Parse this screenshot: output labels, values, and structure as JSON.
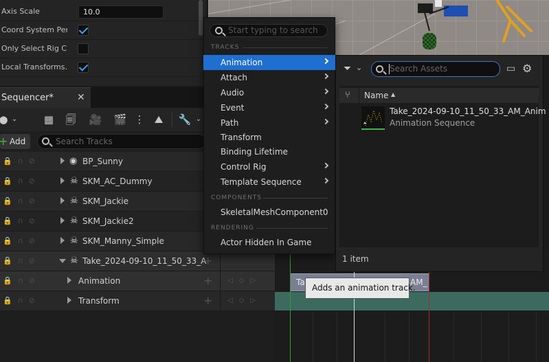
{
  "details": {
    "rows": [
      {
        "label": "Axis Scale",
        "value": "10.0"
      },
      {
        "label": "Coord System Per…",
        "checked": true
      },
      {
        "label": "Only Select Rig C…",
        "checked": false
      },
      {
        "label": "Local Transforms…",
        "checked": true
      }
    ]
  },
  "sequencer": {
    "tab_title": "Sequencer*",
    "add_label": "Add",
    "search_placeholder": "Search Tracks",
    "tracks": [
      {
        "label": "BP_Sunny",
        "icon": "actor-icon"
      },
      {
        "label": "SKM_AC_Dummy",
        "icon": "skeleton-icon"
      },
      {
        "label": "SKM_Jackie",
        "icon": "skeleton-icon"
      },
      {
        "label": "SKM_Jackie2",
        "icon": "skeleton-icon"
      },
      {
        "label": "SKM_Manny_Simple",
        "icon": "skeleton-icon"
      },
      {
        "label": "Take_2024-09-10_11_50_33_A",
        "icon": "skeleton-icon",
        "expanded": true
      },
      {
        "label": "Animation",
        "child": true
      },
      {
        "label": "Transform",
        "child": true
      }
    ]
  },
  "menu": {
    "search_placeholder": "Start typing to search",
    "sections": {
      "tracks": "TRACKS",
      "components": "COMPONENTS",
      "rendering": "RENDERING"
    },
    "items": [
      {
        "label": "Animation",
        "submenu": true,
        "active": true
      },
      {
        "label": "Attach",
        "submenu": true
      },
      {
        "label": "Audio",
        "submenu": true
      },
      {
        "label": "Event",
        "submenu": true
      },
      {
        "label": "Path",
        "submenu": true
      },
      {
        "label": "Transform",
        "submenu": false
      },
      {
        "label": "Binding Lifetime",
        "submenu": false
      },
      {
        "label": "Control Rig",
        "submenu": true
      },
      {
        "label": "Template Sequence",
        "submenu": true
      }
    ],
    "component_item": "SkeletalMeshComponent0",
    "rendering_item": "Actor Hidden In Game"
  },
  "picker": {
    "search_placeholder": "Search Assets",
    "column_name": "Name",
    "asset": {
      "name": "Take_2024-09-10_11_50_33_AM_Anim",
      "type": "Animation Sequence"
    },
    "count": "1 item"
  },
  "timeline": {
    "section_label_left": "Ta",
    "section_label_right": "AM_"
  },
  "tooltip": "Adds an animation track.",
  "colors": {
    "accent": "#1f6fd1",
    "transform_bar": "#3d6a5f",
    "anim_section": "#7a7f93"
  }
}
